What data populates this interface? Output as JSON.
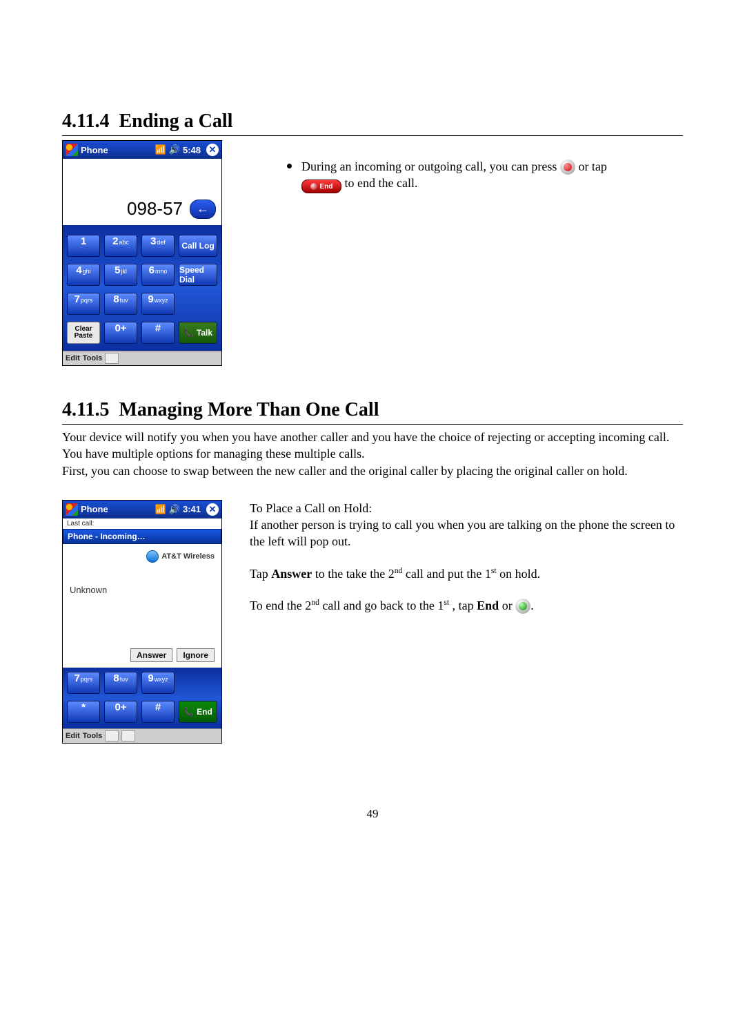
{
  "page_number": "49",
  "sections": {
    "ending": {
      "num": "4.11.4",
      "title": "Ending a Call"
    },
    "managing": {
      "num": "4.11.5",
      "title": "Managing More Than One Call"
    }
  },
  "ending_bullet": {
    "pre": "During an incoming or outgoing call, you can press ",
    "mid": " or tap ",
    "post": " to end the call.",
    "end_pill_label": "End"
  },
  "managing_text": {
    "p1": "Your device will notify you when you have another caller and you have the choice of rejecting or accepting incoming call.  You have multiple options for managing these multiple calls.",
    "p2": "First, you can choose to swap between the new caller and the original caller by placing the original caller on hold.",
    "hold_title": "To Place a Call on Hold:",
    "hold_body": "If another person is trying to call you when you are talking on the phone the screen to the left will pop out.",
    "answer_pre": "Tap ",
    "answer_bold": "Answer",
    "answer_mid": " to the take the 2",
    "answer_mid2": " call and put the 1",
    "answer_post": " on hold.",
    "end_pre": "To end the 2",
    "end_mid": " call and go back to the 1",
    "end_mid2": ", tap ",
    "end_bold": "End",
    "end_post": " or "
  },
  "screenshot1": {
    "title": "Phone",
    "time": "5:48",
    "dialed": "098-57",
    "keys": {
      "1": "1",
      "2": "2",
      "2s": "abc",
      "3": "3",
      "3s": "def",
      "4": "4",
      "4s": "ghi",
      "5": "5",
      "5s": "jkl",
      "6": "6",
      "6s": "mno",
      "7": "7",
      "7s": "pqrs",
      "8": "8",
      "8s": "tuv",
      "9": "9",
      "9s": "wxyz",
      "0": "0+",
      "star": "*",
      "hash": "#"
    },
    "call_log": "Call Log",
    "speed_dial": "Speed Dial",
    "talk": "Talk",
    "clear": "Clear",
    "paste": "Paste",
    "edit": "Edit",
    "tools": "Tools"
  },
  "screenshot2": {
    "title": "Phone",
    "time": "3:41",
    "last_call": "Last call:",
    "incoming": "Phone - Incoming…",
    "carrier": "AT&T Wireless",
    "caller": "Unknown",
    "answer": "Answer",
    "ignore": "Ignore",
    "end": "End",
    "edit": "Edit",
    "tools": "Tools",
    "keys": {
      "7": "7",
      "7s": "pqrs",
      "8": "8",
      "8s": "tuv",
      "9": "9",
      "9s": "wxyz",
      "star": "*",
      "0": "0+",
      "hash": "#"
    }
  }
}
